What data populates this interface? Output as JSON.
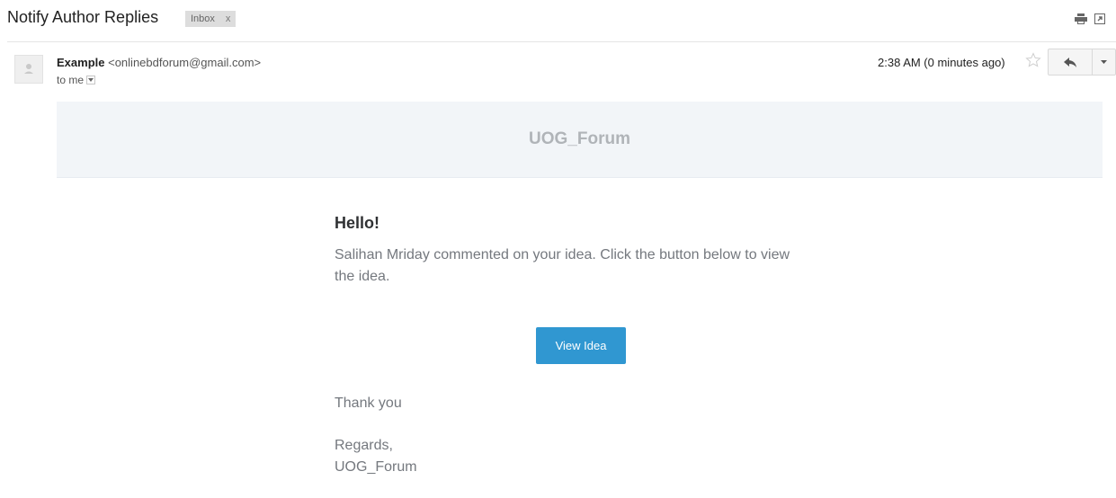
{
  "subject": {
    "title": "Notify Author Replies",
    "label": "Inbox",
    "label_remove": "x"
  },
  "toolbar": {
    "print_icon": "print-icon",
    "new_window_icon": "new-window-icon"
  },
  "message": {
    "sender_name": "Example",
    "sender_email": "<onlinebdforum@gmail.com>",
    "to_line": "to me",
    "timestamp": "2:38 AM (0 minutes ago)",
    "star_icon": "star-icon",
    "reply_icon": "reply-icon",
    "more_icon": "chevron-down-icon"
  },
  "email": {
    "header_title": "UOG_Forum",
    "greeting": "Hello!",
    "body": "Salihan Mriday commented on your idea. Click the button below to view the idea.",
    "button_label": "View Idea",
    "thanks": "Thank you",
    "regards_line1": "Regards,",
    "regards_line2": "UOG_Forum"
  },
  "colors": {
    "button": "#3097d1",
    "header_bg": "#f2f5f8",
    "body_text": "#74787e"
  }
}
